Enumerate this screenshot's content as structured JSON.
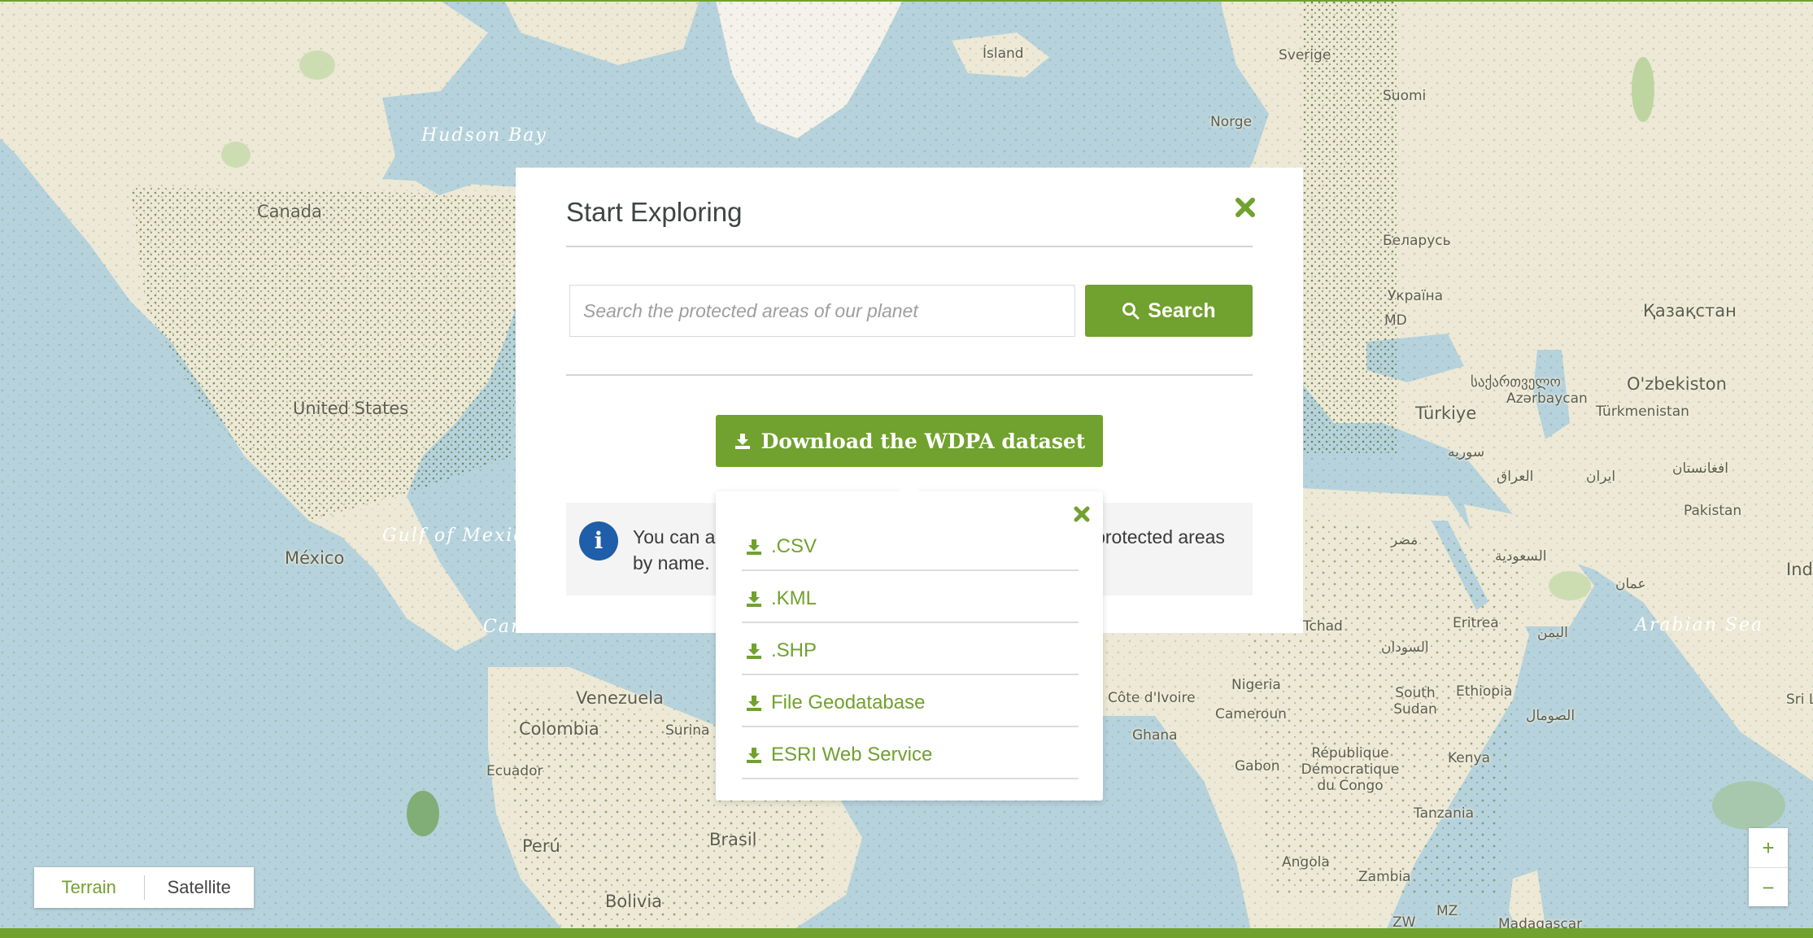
{
  "map": {
    "labels": {
      "island": "Ísland",
      "hudson_bay": "Hudson Bay",
      "canada": "Canada",
      "united_states": "United States",
      "gulf_of_mexico": "Gulf of Mexico",
      "mexico": "México",
      "caribbean_sea": "Caribbean Sea",
      "venezuela": "Venezuela",
      "colombia": "Colombia",
      "suriname": "Surina",
      "ecuador": "Ecuador",
      "peru": "Perú",
      "brasil": "Brasil",
      "bolivia": "Bolivia",
      "norge": "Norge",
      "sverige": "Sverige",
      "suomi": "Suomi",
      "belarus": "Беларусь",
      "ukraine": "Україна",
      "kazakhstan": "Қазақстан",
      "uzbekistan": "O'zbekiston",
      "turkmenistan": "Türkmenistan",
      "turkiye": "Türkiye",
      "georgia": "საქართველო",
      "azerbaijan": "Azərbaycan",
      "afghanistan": "افغانستان",
      "pakistan": "Pakistan",
      "iran": "ایران",
      "iraq": "العراق",
      "syria": "سوريه",
      "saudi": "السعودية",
      "egypt": "مصر",
      "sudan": "السودان",
      "south_sudan": "South Sudan",
      "eritrea": "Eritrea",
      "ethiopia": "Ethiopia",
      "somalia": "الصومال",
      "yemen": "اليمن",
      "oman": "عمان",
      "arabian_sea": "Arabian Sea",
      "chad": "Tchad",
      "nigeria": "Nigeria",
      "cote_divoire": "Côte d'Ivoire",
      "ghana": "Ghana",
      "cameroun": "Cameroun",
      "gabon": "Gabon",
      "rdc": "République Démocratique du Congo",
      "kenya": "Kenya",
      "tanzania": "Tanzania",
      "angola": "Angola",
      "zambia": "Zambia",
      "zw": "ZW",
      "mz": "MZ",
      "madagascar": "Madagascar",
      "india": "Ind",
      "sri_lanka": "Sri L",
      "md": "MD"
    }
  },
  "modal": {
    "title": "Start Exploring",
    "search_placeholder": "Search the protected areas of our planet",
    "search_label": "Search",
    "download_label": "Download the WDPA dataset",
    "info_text": "You can also search for specific countries, regions, and protected areas by name."
  },
  "dropdown": {
    "items": [
      ".CSV",
      ".KML",
      ".SHP",
      "File Geodatabase",
      "ESRI Web Service"
    ]
  },
  "map_type": {
    "terrain": "Terrain",
    "satellite": "Satellite"
  },
  "zoom": {
    "in": "+",
    "out": "−"
  },
  "colors": {
    "accent": "#71a12e",
    "water": "#b6d2dc",
    "land": "#ede9d6",
    "protected": "#5b7d2c",
    "info": "#1f5ea8"
  }
}
